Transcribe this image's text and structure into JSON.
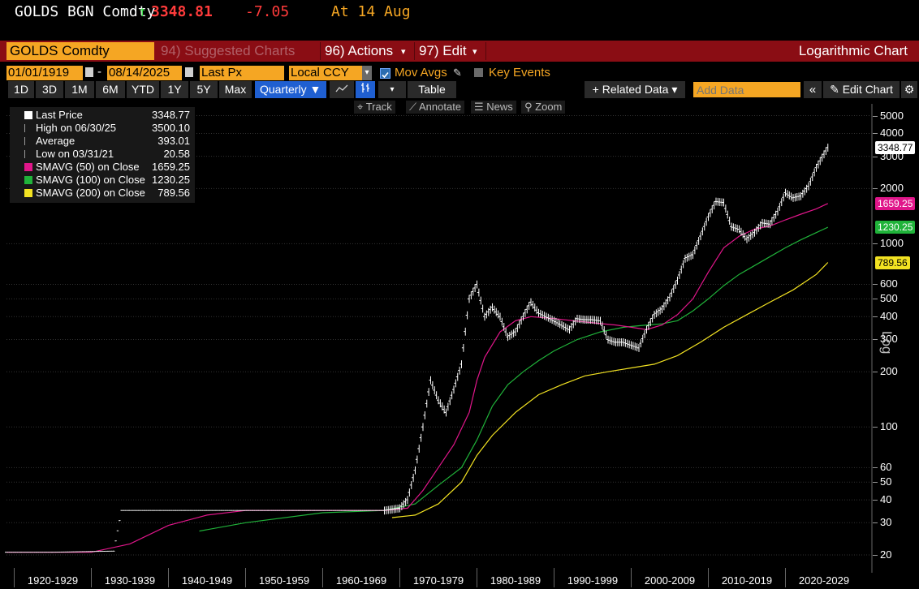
{
  "ticker": {
    "symbol": "GOLDS BGN Comdty",
    "arrow": "↑",
    "last": "3348.81",
    "change": "-7.05",
    "at_date": "At 14 Aug",
    "colors": {
      "last": "#ff3b3b",
      "change": "#ff3b3b",
      "at": "#f5a623",
      "arrow": "#3ddc4a"
    }
  },
  "function_bar": {
    "security": "GOLDS Comdty",
    "suggested": "94) Suggested Charts",
    "actions": "96) Actions",
    "edit": "97) Edit",
    "title": "Logarithmic Chart"
  },
  "controls": {
    "start_date": "01/01/1919",
    "dash": "-",
    "end_date": "08/14/2025",
    "field": "Last Px",
    "currency": "Local CCY",
    "mov_avgs": "Mov Avgs",
    "key_events": "Key Events"
  },
  "periods": [
    "1D",
    "3D",
    "1M",
    "6M",
    "YTD",
    "1Y",
    "5Y",
    "Max"
  ],
  "frequency": "Quarterly",
  "table_label": "Table",
  "related_data": "+ Related Data",
  "add_data_placeholder": "Add Data",
  "edit_chart": "Edit Chart",
  "tools": {
    "track": "Track",
    "annotate": "Annotate",
    "news": "News",
    "zoom": "Zoom"
  },
  "legend": [
    {
      "name": "Last Price",
      "value": "3348.77",
      "color": "#ffffff"
    },
    {
      "name": "High on 06/30/25",
      "value": "3500.10",
      "color": "#bbbbbb"
    },
    {
      "name": "Average",
      "value": "393.01",
      "color": "#bbbbbb"
    },
    {
      "name": "Low on 03/31/21",
      "value": "20.58",
      "color": "#bbbbbb"
    },
    {
      "name": "SMAVG (50)  on Close",
      "value": "1659.25",
      "color": "#e0168a"
    },
    {
      "name": "SMAVG (100)  on Close",
      "value": "1230.25",
      "color": "#20b33a"
    },
    {
      "name": "SMAVG (200)  on Close",
      "value": "789.56",
      "color": "#f2e222"
    }
  ],
  "price_tags": [
    {
      "value": "3348.77",
      "bg": "#ffffff",
      "fg": "#000000"
    },
    {
      "value": "1659.25",
      "bg": "#e0168a",
      "fg": "#ffffff"
    },
    {
      "value": "1230.25",
      "bg": "#20b33a",
      "fg": "#ffffff"
    },
    {
      "value": "789.56",
      "bg": "#f2e222",
      "fg": "#000000"
    }
  ],
  "chart_data": {
    "type": "line",
    "scale": "log",
    "axis_label_right": "Log",
    "y_ticks": [
      20,
      30,
      40,
      50,
      60,
      100,
      200,
      300,
      400,
      500,
      600,
      1000,
      2000,
      3000,
      4000,
      5000
    ],
    "x_decades": [
      "1920-1929",
      "1930-1939",
      "1940-1949",
      "1950-1959",
      "1960-1969",
      "1970-1979",
      "1980-1989",
      "1990-1999",
      "2000-2009",
      "2010-2019",
      "2020-2029"
    ],
    "price": [
      [
        1919,
        20.7
      ],
      [
        1925,
        20.7
      ],
      [
        1933,
        21
      ],
      [
        1934,
        35
      ],
      [
        1950,
        35
      ],
      [
        1968,
        35
      ],
      [
        1970,
        36
      ],
      [
        1971,
        40
      ],
      [
        1972,
        58
      ],
      [
        1973,
        100
      ],
      [
        1974,
        180
      ],
      [
        1975,
        140
      ],
      [
        1976,
        120
      ],
      [
        1977,
        160
      ],
      [
        1978,
        220
      ],
      [
        1979,
        500
      ],
      [
        1980,
        600
      ],
      [
        1981,
        400
      ],
      [
        1982,
        450
      ],
      [
        1983,
        400
      ],
      [
        1984,
        310
      ],
      [
        1985,
        330
      ],
      [
        1986,
        400
      ],
      [
        1987,
        480
      ],
      [
        1988,
        420
      ],
      [
        1989,
        400
      ],
      [
        1990,
        380
      ],
      [
        1991,
        360
      ],
      [
        1992,
        340
      ],
      [
        1993,
        390
      ],
      [
        1994,
        385
      ],
      [
        1995,
        385
      ],
      [
        1996,
        380
      ],
      [
        1997,
        300
      ],
      [
        1998,
        290
      ],
      [
        1999,
        290
      ],
      [
        2000,
        280
      ],
      [
        2001,
        270
      ],
      [
        2002,
        340
      ],
      [
        2003,
        410
      ],
      [
        2004,
        440
      ],
      [
        2005,
        510
      ],
      [
        2006,
        630
      ],
      [
        2007,
        830
      ],
      [
        2008,
        870
      ],
      [
        2009,
        1100
      ],
      [
        2010,
        1400
      ],
      [
        2011,
        1700
      ],
      [
        2012,
        1680
      ],
      [
        2013,
        1240
      ],
      [
        2014,
        1200
      ],
      [
        2015,
        1060
      ],
      [
        2016,
        1150
      ],
      [
        2017,
        1300
      ],
      [
        2018,
        1280
      ],
      [
        2019,
        1500
      ],
      [
        2020,
        1900
      ],
      [
        2021,
        1780
      ],
      [
        2022,
        1820
      ],
      [
        2023,
        2060
      ],
      [
        2024,
        2600
      ],
      [
        2025.5,
        3348
      ]
    ],
    "sma50": [
      [
        1919,
        20.7
      ],
      [
        1930,
        20.7
      ],
      [
        1935,
        23
      ],
      [
        1940,
        29
      ],
      [
        1945,
        33
      ],
      [
        1950,
        35
      ],
      [
        1968,
        35
      ],
      [
        1971,
        36
      ],
      [
        1973,
        45
      ],
      [
        1975,
        60
      ],
      [
        1977,
        80
      ],
      [
        1979,
        120
      ],
      [
        1980,
        180
      ],
      [
        1981,
        240
      ],
      [
        1983,
        330
      ],
      [
        1985,
        380
      ],
      [
        1987,
        400
      ],
      [
        1990,
        390
      ],
      [
        1995,
        370
      ],
      [
        1998,
        360
      ],
      [
        2000,
        350
      ],
      [
        2002,
        340
      ],
      [
        2004,
        360
      ],
      [
        2006,
        410
      ],
      [
        2008,
        500
      ],
      [
        2010,
        700
      ],
      [
        2012,
        950
      ],
      [
        2014,
        1100
      ],
      [
        2016,
        1200
      ],
      [
        2018,
        1250
      ],
      [
        2020,
        1350
      ],
      [
        2022,
        1450
      ],
      [
        2024,
        1550
      ],
      [
        2025.5,
        1659
      ]
    ],
    "sma100": [
      [
        1944,
        27
      ],
      [
        1950,
        30
      ],
      [
        1960,
        34
      ],
      [
        1968,
        35
      ],
      [
        1972,
        38
      ],
      [
        1975,
        48
      ],
      [
        1978,
        60
      ],
      [
        1980,
        85
      ],
      [
        1982,
        130
      ],
      [
        1984,
        170
      ],
      [
        1986,
        200
      ],
      [
        1988,
        230
      ],
      [
        1990,
        260
      ],
      [
        1993,
        300
      ],
      [
        1996,
        330
      ],
      [
        1999,
        350
      ],
      [
        2002,
        360
      ],
      [
        2004,
        365
      ],
      [
        2006,
        380
      ],
      [
        2008,
        430
      ],
      [
        2010,
        500
      ],
      [
        2012,
        590
      ],
      [
        2014,
        680
      ],
      [
        2016,
        760
      ],
      [
        2018,
        850
      ],
      [
        2020,
        950
      ],
      [
        2022,
        1050
      ],
      [
        2024,
        1150
      ],
      [
        2025.5,
        1230
      ]
    ],
    "sma200": [
      [
        1969,
        32
      ],
      [
        1972,
        33
      ],
      [
        1975,
        38
      ],
      [
        1978,
        50
      ],
      [
        1980,
        70
      ],
      [
        1982,
        90
      ],
      [
        1985,
        120
      ],
      [
        1988,
        150
      ],
      [
        1991,
        170
      ],
      [
        1994,
        190
      ],
      [
        1997,
        200
      ],
      [
        2000,
        210
      ],
      [
        2003,
        220
      ],
      [
        2006,
        245
      ],
      [
        2009,
        290
      ],
      [
        2012,
        350
      ],
      [
        2015,
        410
      ],
      [
        2018,
        480
      ],
      [
        2021,
        560
      ],
      [
        2024,
        680
      ],
      [
        2025.5,
        790
      ]
    ],
    "x_range": [
      1919,
      2031
    ],
    "y_range": [
      17,
      5800
    ],
    "grid": true
  }
}
